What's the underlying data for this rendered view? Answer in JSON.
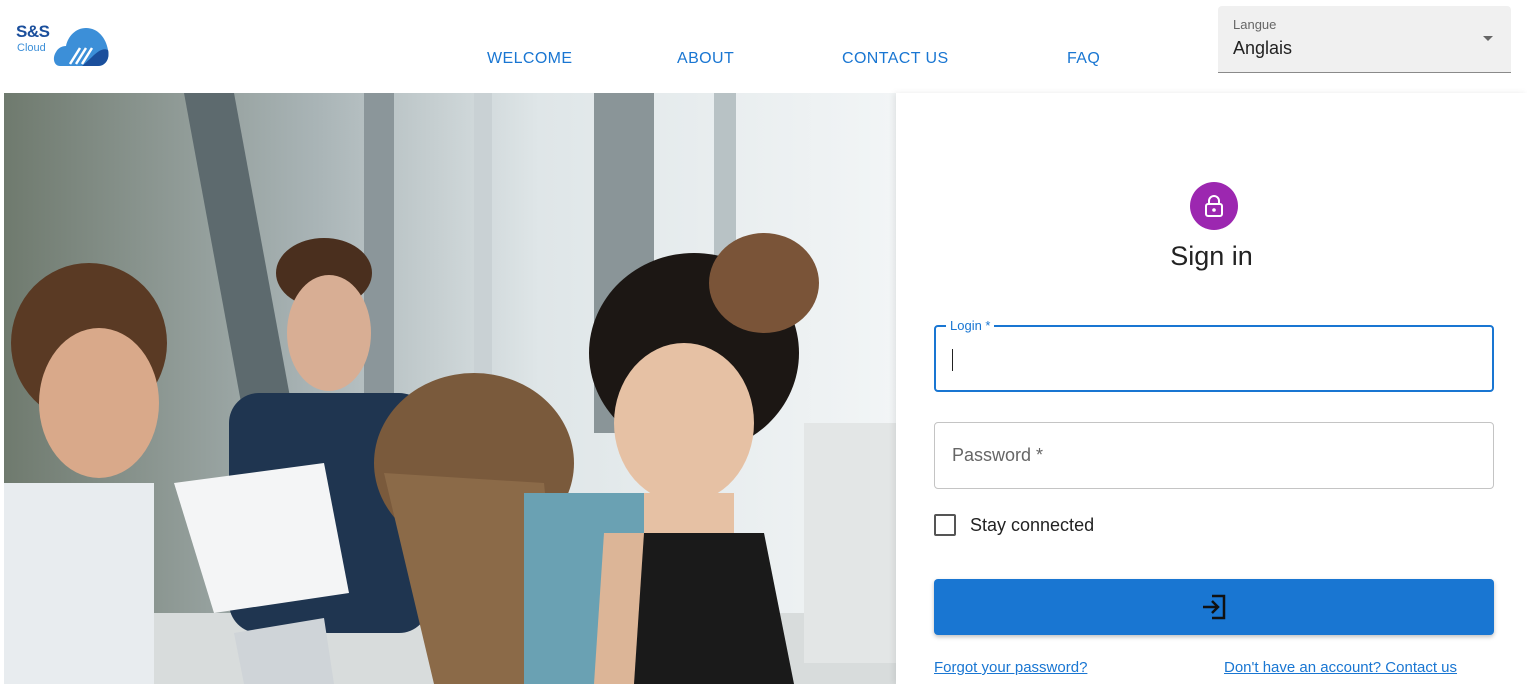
{
  "logo": {
    "primary": "S&S",
    "secondary": "Cloud"
  },
  "nav": [
    {
      "label": "WELCOME"
    },
    {
      "label": "ABOUT"
    },
    {
      "label": "CONTACT US"
    },
    {
      "label": "FAQ"
    }
  ],
  "language": {
    "label": "Langue",
    "value": "Anglais"
  },
  "signin": {
    "title": "Sign in",
    "login_label": "Login *",
    "login_value": "",
    "password_placeholder": "Password *",
    "password_value": "",
    "stay_connected_label": "Stay connected",
    "stay_connected_checked": false,
    "submit_icon": "login-icon",
    "forgot_link": "Forgot your password?",
    "signup_link": "Don't have an account? Contact us"
  },
  "colors": {
    "primary": "#1976d2",
    "avatar": "#9c27b0",
    "logo_dark": "#1b4f9c",
    "logo_light": "#3c8fd8"
  }
}
